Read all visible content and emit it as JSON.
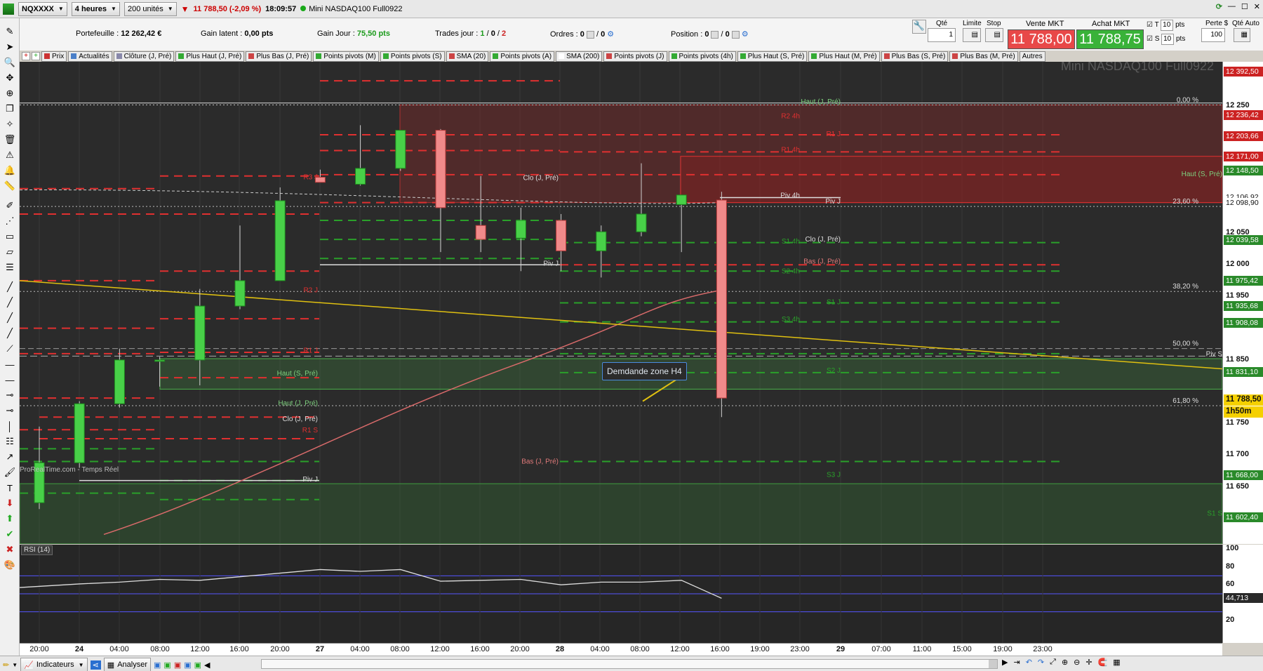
{
  "topbar": {
    "symbol": "NQXXXX",
    "timeframe": "4 heures",
    "units": "200 unités",
    "last_price": "11 788,50 (-2,09 %)",
    "time": "18:09:57",
    "instrument_name": "Mini NASDAQ100 Full0922"
  },
  "infobar": {
    "portfolio_label": "Portefeuille :",
    "portfolio_value": "12 262,42 €",
    "latent_label": "Gain latent :",
    "latent_value": "0,00 pts",
    "day_gain_label": "Gain Jour :",
    "day_gain_value": "75,50 pts",
    "trades_label": "Trades jour :",
    "trades_value_a": "1",
    "trades_value_b": "0",
    "trades_value_c": "2",
    "orders_label": "Ordres :",
    "orders_value_a": "0",
    "orders_value_b": "0",
    "position_label": "Position :",
    "position_value": "0"
  },
  "orderpanel": {
    "qty_label": "Qté",
    "qty_value": "1",
    "limit_label": "Limite",
    "stop_label": "Stop",
    "sell_label": "Vente MKT",
    "sell_price": "11 788,00",
    "buy_label": "Achat MKT",
    "buy_price": "11 788,75",
    "t_label": "T",
    "t_value": "10",
    "s_label": "S",
    "s_value": "10",
    "pts_label": "pts",
    "perte_label": "Perte $",
    "qte_auto_label": "Qté Auto",
    "perte_value": "100"
  },
  "chips": [
    {
      "label": "Prix",
      "color": "#cc3333"
    },
    {
      "label": "Actualités",
      "color": "#4a7fc8"
    },
    {
      "label": "Clôture (J, Pré)",
      "color": "#8888aa"
    },
    {
      "label": "Plus Haut (J, Pré)",
      "color": "#33aa33"
    },
    {
      "label": "Plus Bas (J, Pré)",
      "color": "#cc4444"
    },
    {
      "label": "Points pivots (M)",
      "color": "#33aa33"
    },
    {
      "label": "Points pivots (S)",
      "color": "#33aa33"
    },
    {
      "label": "SMA (20)",
      "color": "#cc4444"
    },
    {
      "label": "Points pivots (A)",
      "color": "#33aa33"
    },
    {
      "label": "SMA (200)",
      "color": "#ffffff"
    },
    {
      "label": "Points pivots (J)",
      "color": "#cc4444"
    },
    {
      "label": "Points pivots (4h)",
      "color": "#33aa33"
    },
    {
      "label": "Plus Haut (S, Pré)",
      "color": "#33aa33"
    },
    {
      "label": "Plus Haut (M, Pré)",
      "color": "#33aa33"
    },
    {
      "label": "Plus Bas (S, Pré)",
      "color": "#cc4444"
    },
    {
      "label": "Plus Bas (M, Pré)",
      "color": "#cc4444"
    },
    {
      "label": "Autres",
      "color": ""
    }
  ],
  "chart": {
    "watermark": "Mini NASDAQ100 Full0922",
    "source_caption": "ProRealTime.com - Temps Réel",
    "annotation": "Demdande zone H4",
    "rsi_label": "RSI (14)",
    "fib_labels": [
      "0,00 %",
      "23,60 %",
      "38,20 %",
      "50,00 %",
      "61,80 %"
    ],
    "level_labels": {
      "haut_j_pre": "Haut (J, Pré)",
      "haut_s_pre": "Haut (S, Pré)",
      "clo_j_pre": "Clo (J, Pré)",
      "bas_j_pre": "Bas (J, Pré)",
      "piv_j": "Piv J",
      "piv_4h": "Piv 4h",
      "piv_s": "Piv S",
      "r1_j": "R1 J",
      "r1_4h": "R1 4h",
      "r2_4h": "R2 4h",
      "r2_j": "R2 J",
      "r3_j": "R3 J",
      "r1_s": "R1 S",
      "s1_4h": "S1 4h",
      "s2_4h": "S2 4h",
      "s3_4h": "S3 4h",
      "s1_j": "S1 J",
      "s2_j": "S2 J",
      "s3_j": "S3 J",
      "s1_s": "S1 S"
    }
  },
  "price_axis": {
    "ticks": [
      "12 250",
      "12 050",
      "12 000",
      "11 950",
      "11 850",
      "11 750",
      "11 700",
      "11 650"
    ],
    "tags": [
      {
        "text": "12 392,50",
        "color": "#cc2222"
      },
      {
        "text": "12 236,42",
        "color": "#cc2222"
      },
      {
        "text": "12 203,66",
        "color": "#cc2222"
      },
      {
        "text": "12 171,00",
        "color": "#cc2222"
      },
      {
        "text": "12 148,50",
        "color": "#2a8a2a"
      },
      {
        "text": "12 106,92",
        "color": "#ffffff"
      },
      {
        "text": "12 098,90",
        "color": "#ffffff"
      },
      {
        "text": "12 039,58",
        "color": "#2a8a2a"
      },
      {
        "text": "11 975,42",
        "color": "#2a8a2a"
      },
      {
        "text": "11 935,68",
        "color": "#2a8a2a"
      },
      {
        "text": "11 908,08",
        "color": "#2a8a2a"
      },
      {
        "text": "11 831,10",
        "color": "#2a8a2a"
      },
      {
        "text": "11 668,00",
        "color": "#2a8a2a"
      },
      {
        "text": "11 602,40",
        "color": "#2a8a2a"
      }
    ],
    "current_price": "11 788,50",
    "countdown": "1h50m"
  },
  "rsi_axis": {
    "ticks": [
      "100",
      "80",
      "60",
      "20"
    ],
    "current": "44,713"
  },
  "time_axis": {
    "labels": [
      {
        "t": "20:00",
        "bold": false
      },
      {
        "t": "24",
        "bold": true
      },
      {
        "t": "04:00",
        "bold": false
      },
      {
        "t": "08:00",
        "bold": false
      },
      {
        "t": "12:00",
        "bold": false
      },
      {
        "t": "16:00",
        "bold": false
      },
      {
        "t": "20:00",
        "bold": false
      },
      {
        "t": "27",
        "bold": true
      },
      {
        "t": "04:00",
        "bold": false
      },
      {
        "t": "08:00",
        "bold": false
      },
      {
        "t": "12:00",
        "bold": false
      },
      {
        "t": "16:00",
        "bold": false
      },
      {
        "t": "20:00",
        "bold": false
      },
      {
        "t": "28",
        "bold": true
      },
      {
        "t": "04:00",
        "bold": false
      },
      {
        "t": "08:00",
        "bold": false
      },
      {
        "t": "12:00",
        "bold": false
      },
      {
        "t": "16:00",
        "bold": false
      },
      {
        "t": "19:00",
        "bold": false
      },
      {
        "t": "23:00",
        "bold": false
      },
      {
        "t": "29",
        "bold": true
      },
      {
        "t": "07:00",
        "bold": false
      },
      {
        "t": "11:00",
        "bold": false
      },
      {
        "t": "15:00",
        "bold": false
      },
      {
        "t": "19:00",
        "bold": false
      },
      {
        "t": "23:00",
        "bold": false
      }
    ]
  },
  "bottombar": {
    "indicators_label": "Indicateurs",
    "analyze_label": "Analyser"
  },
  "candles": [
    {
      "o": 11625,
      "h": 11745,
      "l": 11615,
      "c": 11688
    },
    {
      "o": 11688,
      "h": 11785,
      "l": 11680,
      "c": 11781
    },
    {
      "o": 11781,
      "h": 11868,
      "l": 11775,
      "c": 11850
    },
    {
      "o": 11850,
      "h": 11855,
      "l": 11808,
      "c": 11850
    },
    {
      "o": 11850,
      "h": 11962,
      "l": 11810,
      "c": 11935
    },
    {
      "o": 11935,
      "h": 12062,
      "l": 11930,
      "c": 11975
    },
    {
      "o": 11975,
      "h": 12122,
      "l": 11993,
      "c": 12101
    },
    {
      "o": 12138,
      "h": 12150,
      "l": 12130,
      "c": 12130
    },
    {
      "o": 12127,
      "h": 12220,
      "l": 12125,
      "c": 12152
    },
    {
      "o": 12152,
      "h": 12210,
      "l": 12148,
      "c": 12212
    },
    {
      "o": 12212,
      "h": 12214,
      "l": 12020,
      "c": 12090
    },
    {
      "o": 12062,
      "h": 12140,
      "l": 12020,
      "c": 12040
    },
    {
      "o": 12042,
      "h": 12090,
      "l": 11990,
      "c": 12070
    },
    {
      "o": 12070,
      "h": 12080,
      "l": 11990,
      "c": 12022
    },
    {
      "o": 12022,
      "h": 12062,
      "l": 11980,
      "c": 12052
    },
    {
      "o": 12052,
      "h": 12160,
      "l": 12045,
      "c": 12080
    },
    {
      "o": 12095,
      "h": 12110,
      "l": 12020,
      "c": 12110
    },
    {
      "o": 12102,
      "h": 12115,
      "l": 11760,
      "c": 11790
    }
  ],
  "rsi_values": [
    57,
    61,
    63,
    66,
    65,
    69,
    73,
    77,
    75,
    77,
    64,
    65,
    66,
    60,
    63,
    63,
    65,
    45
  ]
}
